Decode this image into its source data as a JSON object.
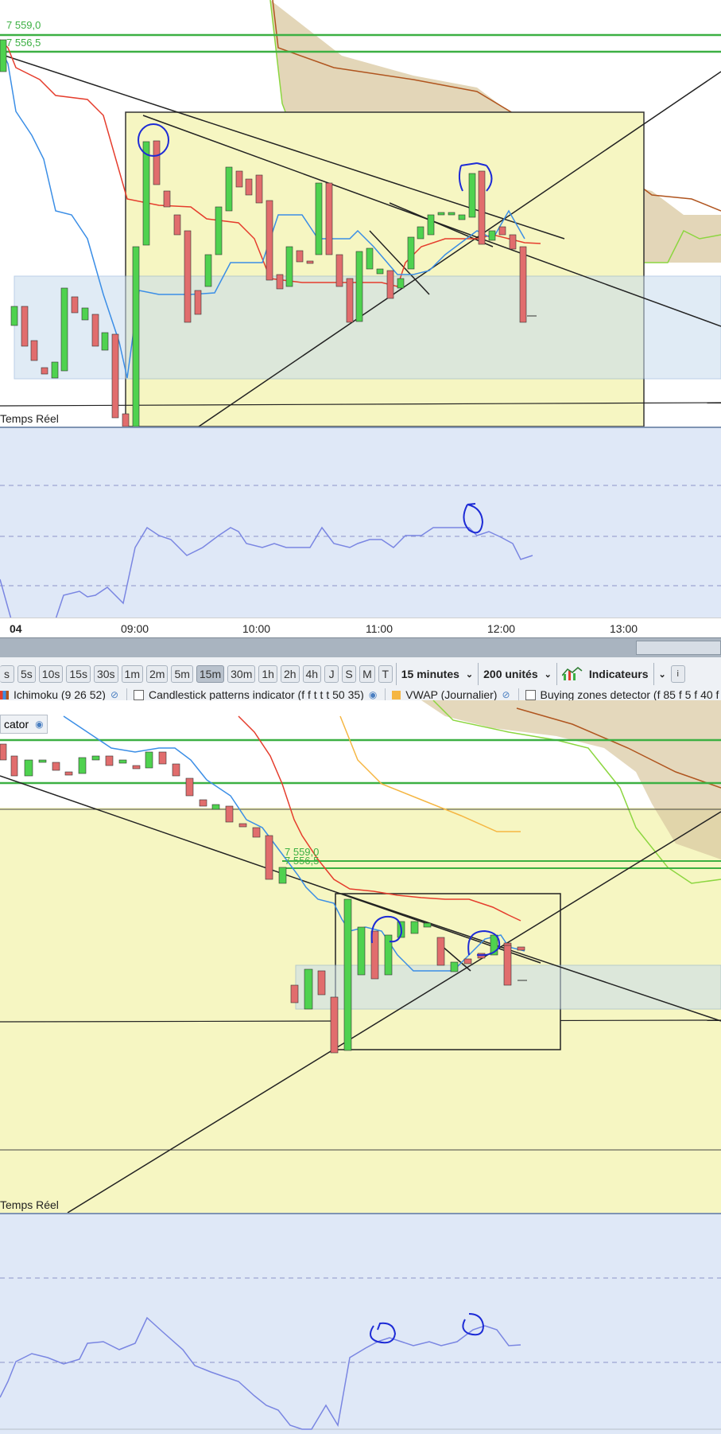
{
  "colors": {
    "tenkan_red": "#e53d2d",
    "kijun_blue": "#3b8ee6",
    "bull_green": "#4fd24f",
    "bear_red": "#e16d6d",
    "cloud_fill": "#d9c8a0",
    "zone_yellow": "#f6f6c2",
    "rsi_bg": "#dfe8f7",
    "rsi_line": "#7a86e2",
    "annotation_blue": "#1d2bd6",
    "level_green": "#3cb043"
  },
  "top_chart": {
    "price_labels": [
      "7 559,0",
      "7 556,5"
    ],
    "status_label": "Temps Réel"
  },
  "time_axis": {
    "labels": [
      "04",
      "09:00",
      "10:00",
      "11:00",
      "12:00",
      "13:00"
    ]
  },
  "toolbar": {
    "timeframes": [
      "s",
      "5s",
      "10s",
      "15s",
      "30s",
      "1m",
      "2m",
      "5m",
      "15m",
      "30m",
      "1h",
      "2h",
      "4h",
      "J",
      "S",
      "M",
      "T"
    ],
    "active_timeframe": "15m",
    "interval_select": "15 minutes",
    "units_select": "200 unités",
    "indicators_label": "Indicateurs",
    "indicators_icon": "indicators-chart-icon",
    "info_icon": "info-icon"
  },
  "indicators": [
    {
      "label": "Ichimoku (9 26 52)",
      "icon": "visibility-off-icon"
    },
    {
      "label": "Candlestick patterns indicator (f f t t t 50 35)",
      "icon": "eye-icon"
    },
    {
      "label": "VWAP (Journalier)",
      "icon": "visibility-off-icon"
    },
    {
      "label": "Buying zones detector (f 85 f 5 f 40 f",
      "icon": ""
    }
  ],
  "badge": {
    "label": "cator",
    "icon": "eye-icon"
  },
  "bottom_chart": {
    "price_labels": [
      "7 559,0",
      "7 556,5"
    ],
    "status_label": "Temps Réel"
  }
}
